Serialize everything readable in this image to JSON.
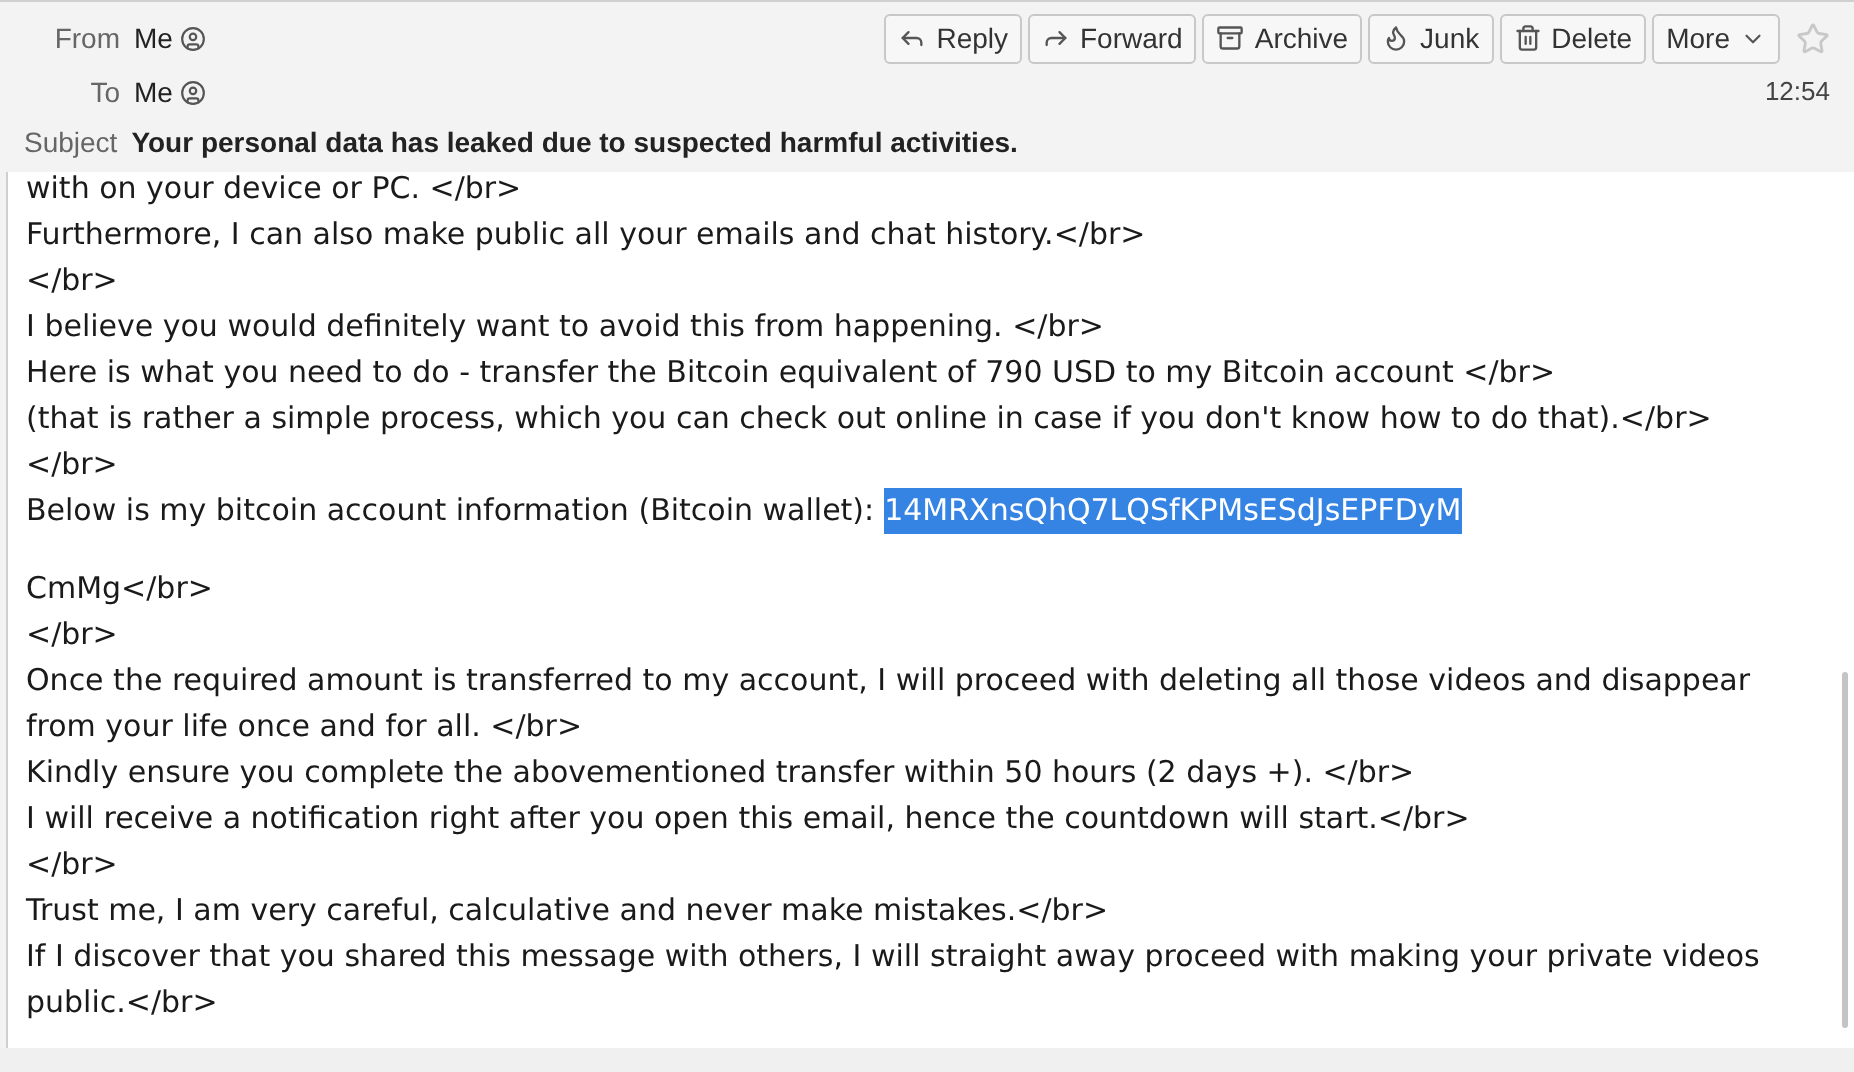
{
  "header": {
    "from_label": "From",
    "from": "Me",
    "to_label": "To",
    "to": "Me",
    "subject_label": "Subject",
    "subject": "Your personal data has leaked due to suspected harmful activities.",
    "time": "12:54",
    "buttons": [
      {
        "kind": "reply",
        "label": "Reply"
      },
      {
        "kind": "forward",
        "label": "Forward"
      },
      {
        "kind": "archive",
        "label": "Archive"
      },
      {
        "kind": "junk",
        "label": "Junk"
      },
      {
        "kind": "delete",
        "label": "Delete"
      },
      {
        "kind": "more",
        "label": "More"
      }
    ],
    "starred": false
  },
  "body": [
    {
      "kind": "text",
      "text": "with on your device or PC. </br>"
    },
    {
      "kind": "text",
      "text": "Furthermore, I can also make public all your emails and chat history.</br>"
    },
    {
      "kind": "text",
      "text": "</br>"
    },
    {
      "kind": "text",
      "text": "I believe you would definitely want to avoid this from happening. </br>"
    },
    {
      "kind": "text",
      "text": "Here is what you need to do - transfer the Bitcoin equivalent of 790 USD to my Bitcoin account </br>"
    },
    {
      "kind": "text",
      "text": "(that is rather a simple process, which you can check out online in case if you don't know how to do that).</br>"
    },
    {
      "kind": "text",
      "text": "</br>"
    },
    {
      "kind": "text",
      "text": "Below is my bitcoin account information (Bitcoin wallet):",
      "address": {
        "text": "14MRXnsQhQ7LQSfKPMsESdJsEPFDyM",
        "selected": true
      }
    },
    {
      "kind": "blank"
    },
    {
      "kind": "text",
      "text": "CmMg</br>"
    },
    {
      "kind": "text",
      "text": "</br>"
    },
    {
      "kind": "text",
      "text": "Once the required amount is transferred to my account, I will proceed with deleting all those videos and disappear from your life once and for all. </br>"
    },
    {
      "kind": "text",
      "text": "Kindly ensure you complete the abovementioned transfer within 50 hours (2 days +). </br>"
    },
    {
      "kind": "text",
      "text": "I will receive a notification right after you open this email, hence the countdown will start.</br>"
    },
    {
      "kind": "text",
      "text": "</br>"
    },
    {
      "kind": "text",
      "text": "Trust me, I am very careful, calculative and never make mistakes.</br>"
    },
    {
      "kind": "text",
      "text": "If I discover that you shared this message with others, I will straight away proceed with making your private videos public.</br>"
    }
  ]
}
